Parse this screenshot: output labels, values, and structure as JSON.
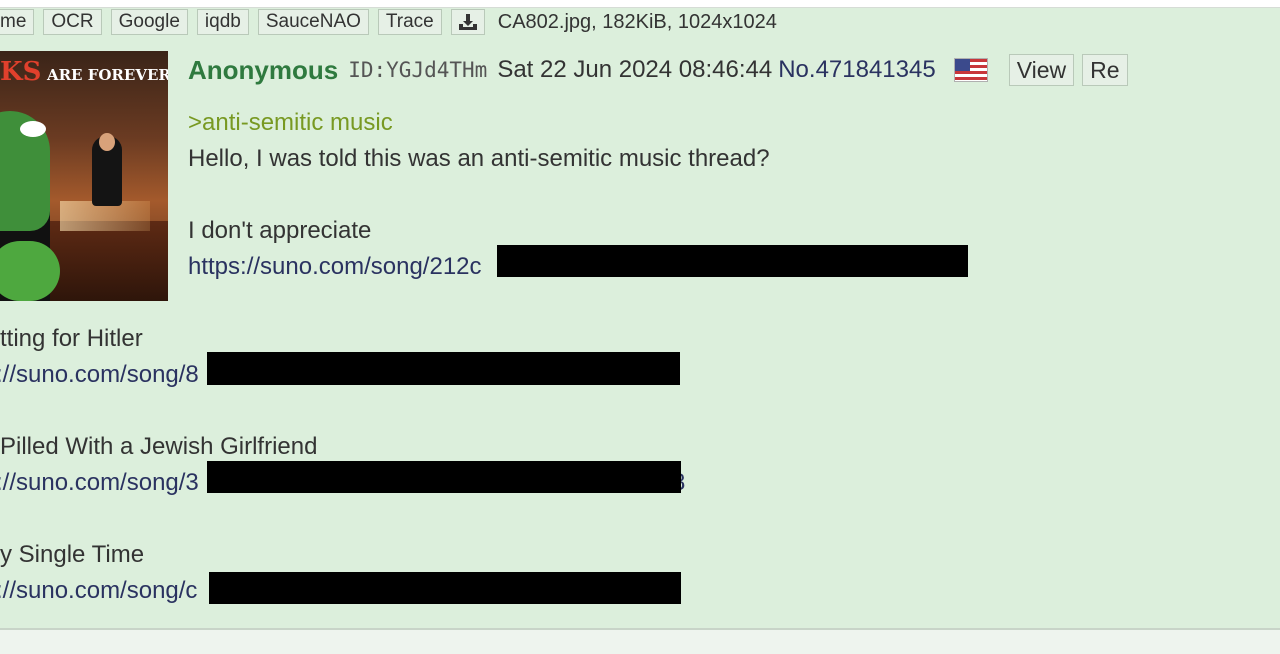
{
  "toolbar": {
    "buttons": [
      "me",
      "OCR",
      "Google",
      "iqdb",
      "SauceNAO",
      "Trace"
    ],
    "download_icon": "download-icon",
    "file_info": "CA802.jpg, 182KiB, 1024x1024"
  },
  "thumbnail": {
    "title_big": "KS",
    "title_small": "ARE FOREVER"
  },
  "post": {
    "name": "Anonymous",
    "poster_id": "ID:YGJd4THm",
    "date": "Sat 22 Jun 2024 08:46:44",
    "number": "No.471841345",
    "flag": "us-flag-icon",
    "actions": [
      "View",
      "Re"
    ]
  },
  "body": {
    "greentext": ">anti-semitic music",
    "line1": "Hello, I was told this was an anti-semitic music thread?",
    "line2": "I don't appreciate",
    "link1": "https://suno.com/song/212c",
    "title2": "tting for Hitler",
    "link2": "://suno.com/song/8",
    "title3": "Pilled With a Jewish Girlfriend",
    "link3": "://suno.com/song/3",
    "link3_tail": "8",
    "title4": "y Single Time",
    "link4": "://suno.com/song/c"
  },
  "colors": {
    "post_bg": "#dcefdc",
    "name": "#2f7a3f",
    "greentext": "#789922",
    "link": "#2a3260"
  }
}
